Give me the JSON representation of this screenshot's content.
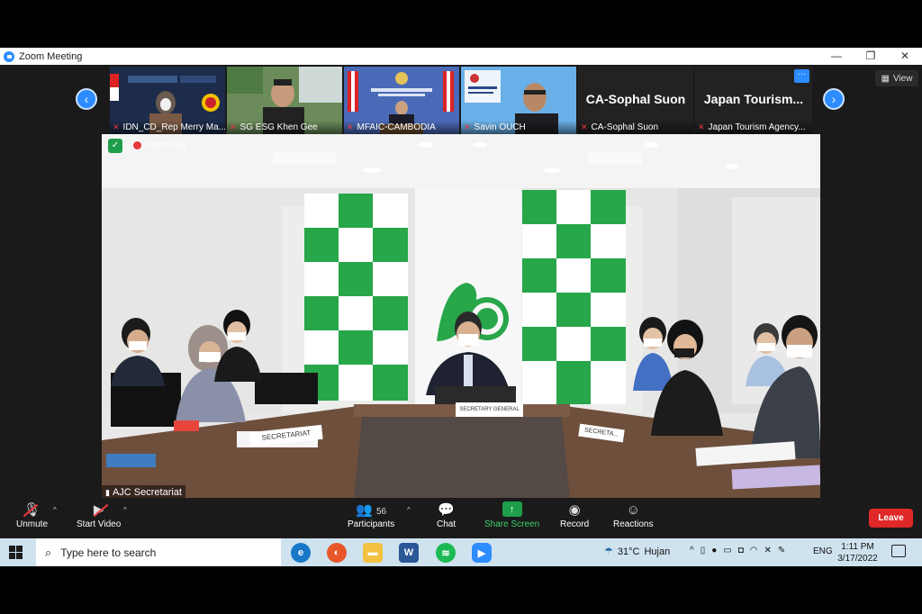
{
  "window": {
    "title": "Zoom Meeting",
    "controls": {
      "minimize": "—",
      "restore": "❐",
      "close": "✕"
    }
  },
  "gallery": {
    "prev_icon": "chevron-left-icon",
    "next_icon": "chevron-right-icon",
    "participants": [
      {
        "name": "IDN_CD_Rep Merry Ma...",
        "muted": true,
        "video": true
      },
      {
        "name": "SG ESG Khen Gee",
        "muted": true,
        "video": true
      },
      {
        "name": "MFAIC-CAMBODIA",
        "muted": true,
        "video": true
      },
      {
        "name": "Savin OUCH",
        "muted": true,
        "video": true
      },
      {
        "name": "CA-Sophal Suon",
        "display": "CA-Sophal Suon",
        "muted": true,
        "video": false
      },
      {
        "name": "Japan Tourism Agency...",
        "display": "Japan Tourism...",
        "muted": true,
        "video": false
      }
    ],
    "more_label": "···"
  },
  "view_button": {
    "label": "View"
  },
  "main_video": {
    "speaker": "AJC Secretariat",
    "recording_label": "Recording",
    "placards": [
      "SECRETARY GENERAL",
      "SECRETARIAT",
      "SECRETA..."
    ]
  },
  "toolbar": {
    "unmute": "Unmute",
    "start_video": "Start Video",
    "participants": "Participants",
    "participants_count": "56",
    "chat": "Chat",
    "share_screen": "Share Screen",
    "record": "Record",
    "reactions": "Reactions",
    "leave": "Leave"
  },
  "taskbar": {
    "search_placeholder": "Type here to search",
    "weather_temp": "31°C",
    "weather_text": "Hujan",
    "language": "ENG",
    "time": "1:11 PM",
    "date": "3/17/2022",
    "apps": [
      "edge",
      "firefox",
      "file-explorer",
      "word",
      "spotify",
      "zoom"
    ]
  },
  "colors": {
    "zoom_blue": "#2d8cff",
    "leave_red": "#e02828",
    "share_green": "#1e9e4a",
    "taskbar": "#cfe3ef"
  }
}
